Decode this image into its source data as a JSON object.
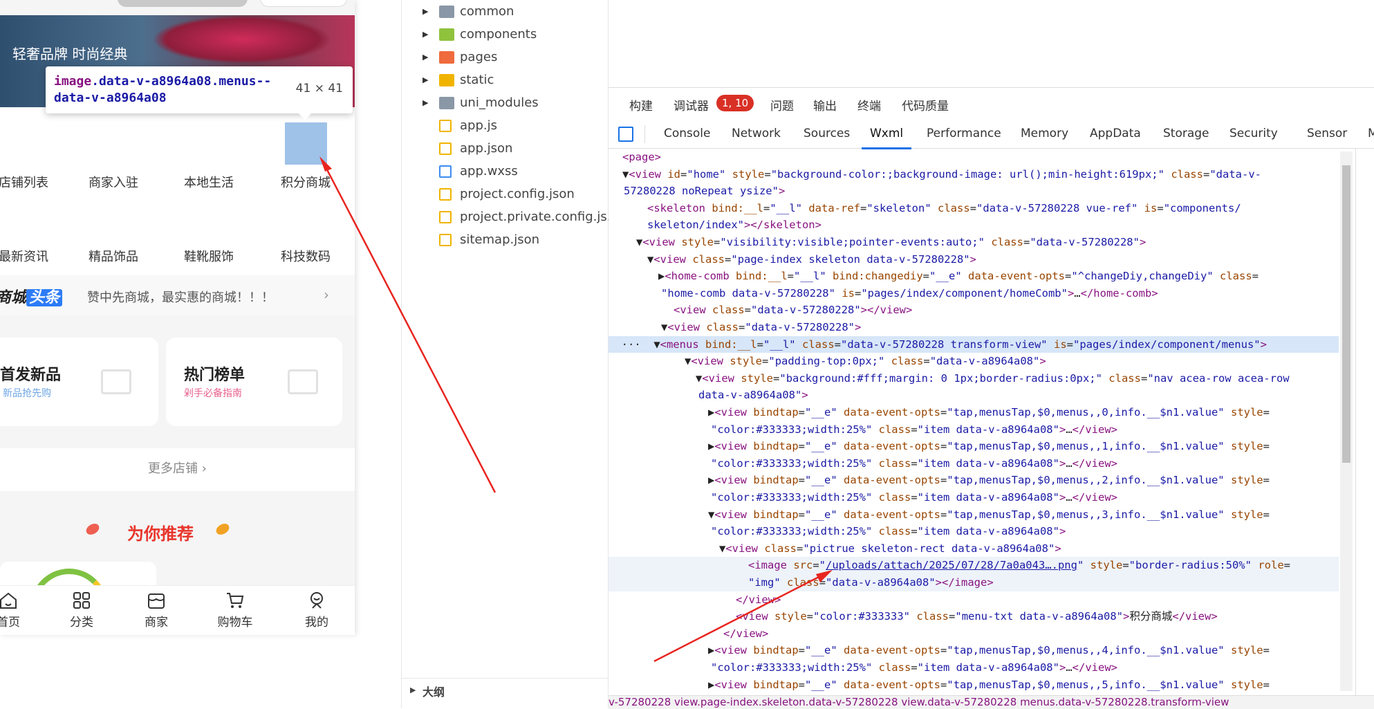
{
  "phone": {
    "banner_text": "轻奢品牌 时尚经典",
    "tooltip": {
      "tag": "image",
      "classes": ".data-v-a8964a08.menus--data-v-a8964a08",
      "size": "41 × 41"
    },
    "menus_row1": [
      "店铺列表",
      "商家入驻",
      "本地生活",
      "积分商城"
    ],
    "menus_row2": [
      "最新资讯",
      "精品饰品",
      "鞋靴服饰",
      "科技数码"
    ],
    "news": {
      "logo_prefix": "商城",
      "logo_highlight": "头条",
      "text": "赞中先商城，最实惠的商城！！！",
      "arrow": "›"
    },
    "cards": [
      {
        "title": "首发新品",
        "subtitle": "新品抢先购",
        "color": "#6ea6e6"
      },
      {
        "title": "热门榜单",
        "subtitle": "剁手必备指南",
        "color": "#e8618c"
      }
    ],
    "more_shops": "更多店铺 ›",
    "recommend_title": "为你推荐",
    "tabbar": [
      "首页",
      "分类",
      "商家",
      "购物车",
      "我的"
    ]
  },
  "filetree": {
    "items": [
      {
        "name": "common",
        "type": "folder",
        "color": "#8a97a6"
      },
      {
        "name": "components",
        "type": "folder",
        "color": "#8fc23d"
      },
      {
        "name": "pages",
        "type": "folder",
        "color": "#ef6a3c"
      },
      {
        "name": "static",
        "type": "folder",
        "color": "#f0b400"
      },
      {
        "name": "uni_modules",
        "type": "folder",
        "color": "#8a97a6"
      },
      {
        "name": "app.js",
        "type": "js",
        "color": "#f0b400"
      },
      {
        "name": "app.json",
        "type": "json",
        "color": "#f0b400"
      },
      {
        "name": "app.wxss",
        "type": "wxss",
        "color": "#3c8cf0"
      },
      {
        "name": "project.config.json",
        "type": "json",
        "color": "#f0b400"
      },
      {
        "name": "project.private.config.js...",
        "type": "json",
        "color": "#f0b400"
      },
      {
        "name": "sitemap.json",
        "type": "json",
        "color": "#f0b400"
      }
    ],
    "outline_label": "大纲"
  },
  "devtools": {
    "top_items": [
      "构建",
      "调试器",
      "问题",
      "输出",
      "终端",
      "代码质量"
    ],
    "badge": "1, 10",
    "tabs": [
      "Console",
      "Network",
      "Sources",
      "Wxml",
      "Performance",
      "Memory",
      "AppData",
      "Storage",
      "Security",
      "Sensor",
      "M"
    ],
    "active_tab": "Wxml",
    "breadcrumbs": "v-57280228   view.page-index.skeleton.data-v-57280228   view.data-v-57280228   menus.data-v-57280228.transform-view"
  }
}
